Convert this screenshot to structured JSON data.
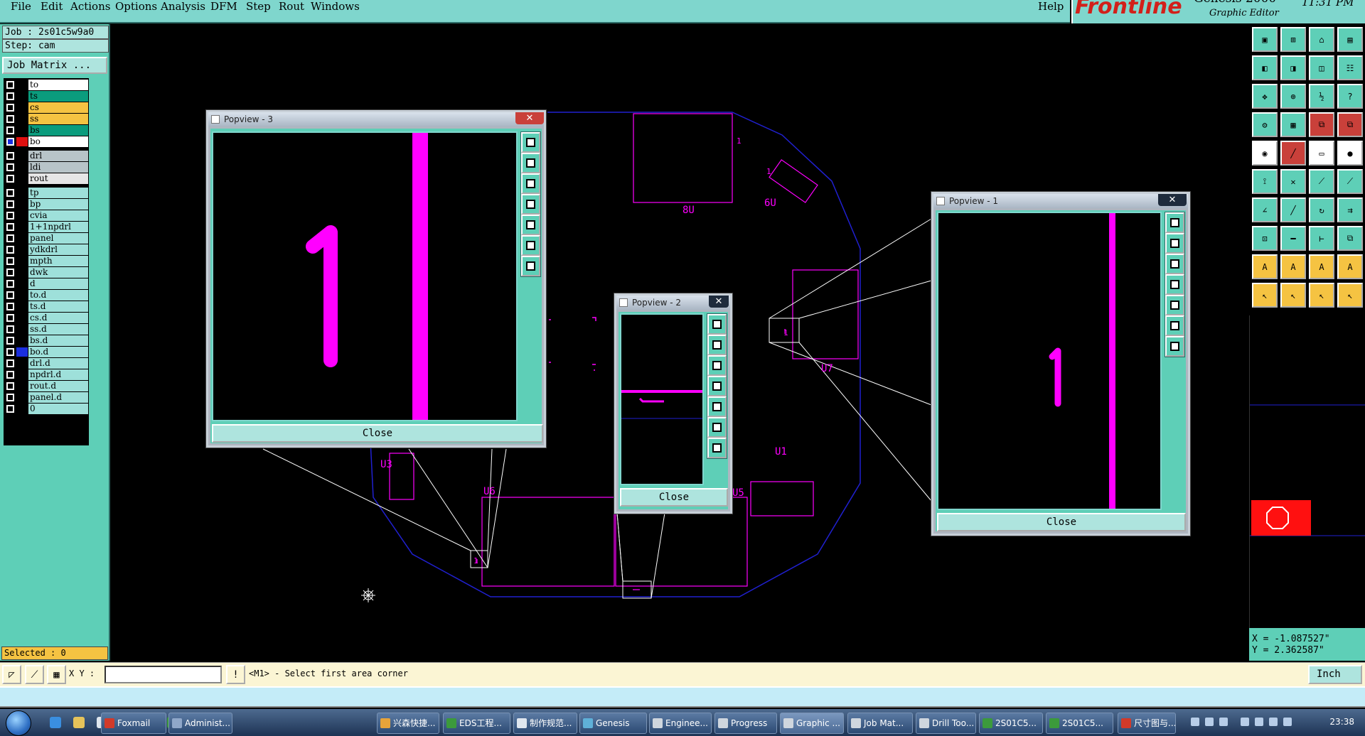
{
  "menubar": {
    "items": [
      {
        "label": "File"
      },
      {
        "label": "Edit"
      },
      {
        "label": "Actions"
      },
      {
        "label": "Options"
      },
      {
        "label": "Analysis"
      },
      {
        "label": "DFM"
      },
      {
        "label": "Step"
      },
      {
        "label": "Rout"
      },
      {
        "label": "Windows"
      }
    ],
    "help": "Help"
  },
  "brand": {
    "logo": "Frontline",
    "product": "Genesis 2000",
    "subtitle": "Graphic Editor",
    "clock": "11:31 PM"
  },
  "job": {
    "job_label": "Job : 2s01c5w9a0",
    "step_label": "Step: cam",
    "matrix_button": "Job Matrix ...",
    "selected": "Selected : 0"
  },
  "layers": [
    {
      "name": "to",
      "bg": "#ffffff",
      "swatch": "#000000",
      "mark": false
    },
    {
      "name": "ts",
      "bg": "#0b9c7d",
      "swatch": "#000000",
      "mark": false
    },
    {
      "name": "cs",
      "bg": "#f5c342",
      "swatch": "#000000",
      "mark": false
    },
    {
      "name": "ss",
      "bg": "#f5c342",
      "swatch": "#000000",
      "mark": false
    },
    {
      "name": "bs",
      "bg": "#0b9c7d",
      "swatch": "#000000",
      "mark": false
    },
    {
      "name": "bo",
      "bg": "#ffffff",
      "swatch": "#e01010",
      "mark": true
    },
    {
      "name": "drl",
      "bg": "#b8c4c8",
      "swatch": "#000000",
      "mark": false
    },
    {
      "name": "ldi",
      "bg": "#b8c4c8",
      "swatch": "#000000",
      "mark": false
    },
    {
      "name": "rout",
      "bg": "#e6e6e6",
      "swatch": "#000000",
      "mark": false
    },
    {
      "name": "tp",
      "bg": "#9ee0da",
      "swatch": "#000000",
      "mark": false
    },
    {
      "name": "bp",
      "bg": "#9ee0da",
      "swatch": "#000000",
      "mark": false
    },
    {
      "name": "cvia",
      "bg": "#9ee0da",
      "swatch": "#000000",
      "mark": false
    },
    {
      "name": "1+1npdrl",
      "bg": "#9ee0da",
      "swatch": "#000000",
      "mark": false
    },
    {
      "name": "panel",
      "bg": "#9ee0da",
      "swatch": "#000000",
      "mark": false
    },
    {
      "name": "ydkdrl",
      "bg": "#9ee0da",
      "swatch": "#000000",
      "mark": false
    },
    {
      "name": "mpth",
      "bg": "#9ee0da",
      "swatch": "#000000",
      "mark": false
    },
    {
      "name": "dwk",
      "bg": "#9ee0da",
      "swatch": "#000000",
      "mark": false
    },
    {
      "name": "d",
      "bg": "#9ee0da",
      "swatch": "#000000",
      "mark": false
    },
    {
      "name": "to.d",
      "bg": "#9ee0da",
      "swatch": "#000000",
      "mark": false
    },
    {
      "name": "ts.d",
      "bg": "#9ee0da",
      "swatch": "#000000",
      "mark": false
    },
    {
      "name": "cs.d",
      "bg": "#9ee0da",
      "swatch": "#000000",
      "mark": false
    },
    {
      "name": "ss.d",
      "bg": "#9ee0da",
      "swatch": "#000000",
      "mark": false
    },
    {
      "name": "bs.d",
      "bg": "#9ee0da",
      "swatch": "#000000",
      "mark": false
    },
    {
      "name": "bo.d",
      "bg": "#9ee0da",
      "swatch": "#1a2fe0",
      "mark": false
    },
    {
      "name": "drl.d",
      "bg": "#9ee0da",
      "swatch": "#000000",
      "mark": false
    },
    {
      "name": "npdrl.d",
      "bg": "#9ee0da",
      "swatch": "#000000",
      "mark": false
    },
    {
      "name": "rout.d",
      "bg": "#9ee0da",
      "swatch": "#000000",
      "mark": false
    },
    {
      "name": "panel.d",
      "bg": "#9ee0da",
      "swatch": "#000000",
      "mark": false
    },
    {
      "name": "0",
      "bg": "#9ee0da",
      "swatch": "#000000",
      "mark": false
    }
  ],
  "popviews": [
    {
      "title": "Popview - 3",
      "close": "Close",
      "label": "1"
    },
    {
      "title": "Popview - 2",
      "close": "Close"
    },
    {
      "title": "Popview - 1",
      "close": "Close",
      "label": "1"
    }
  ],
  "canvas_labels": [
    "8U",
    "6U",
    "U7",
    "U1",
    "U6",
    "U5",
    "U3",
    "1",
    "1",
    "1",
    "1"
  ],
  "coords": {
    "x": "X = -1.087527\"",
    "y": "Y = 2.362587\""
  },
  "command": {
    "xy_label": "X Y :",
    "xy_value": "",
    "message": "<M1> - Select first area corner",
    "unit": "Inch"
  },
  "taskbar": {
    "quick_launch": [
      "ie-icon",
      "explorer-icon",
      "notepad-icon",
      "office-icon",
      "app-icon",
      "excel-icon",
      "word-icon"
    ],
    "tasks": [
      {
        "label": "Foxmail",
        "color": "#d23a2a"
      },
      {
        "label": "Administ...",
        "color": "#8fa7c9"
      },
      {
        "label": "兴森快捷...",
        "color": "#e6a33a"
      },
      {
        "label": "EDS工程...",
        "color": "#3c9a3c"
      },
      {
        "label": "制作规范...",
        "color": "#dfe6ee"
      },
      {
        "label": "Genesis",
        "color": "#5fb0d8"
      },
      {
        "label": "Enginee...",
        "color": "#cfd6de"
      },
      {
        "label": "Progress",
        "color": "#cfd6de"
      },
      {
        "label": "Graphic ...",
        "color": "#cfd6de"
      },
      {
        "label": "Job Mat...",
        "color": "#cfd6de"
      },
      {
        "label": "Drill Too...",
        "color": "#cfd6de"
      },
      {
        "label": "2S01C5...",
        "color": "#3c9a3c"
      },
      {
        "label": "2S01C5...",
        "color": "#3c9a3c"
      },
      {
        "label": "尺寸图与...",
        "color": "#d23a2a"
      }
    ],
    "time": "23:38"
  },
  "colors": {
    "teal": "#5ecfb7",
    "light_teal": "#aee4de",
    "magenta": "#ff00ff",
    "board_outline": "#2020d0"
  }
}
